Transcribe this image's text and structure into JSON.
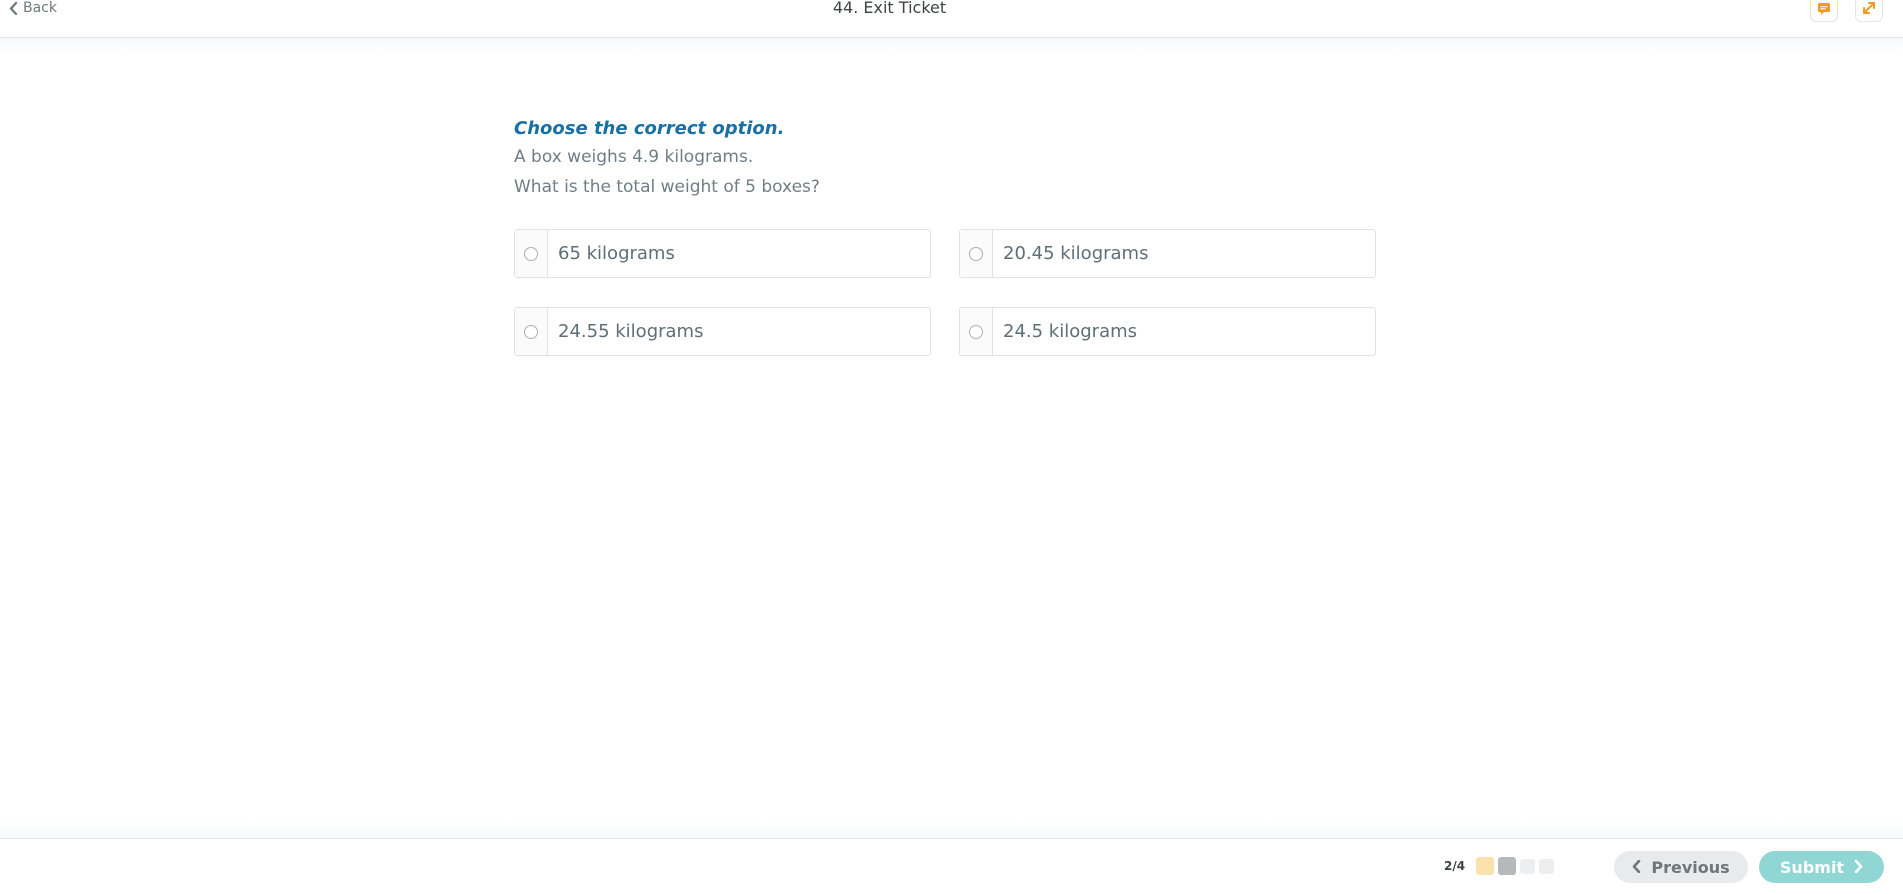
{
  "header": {
    "back_label": "Back",
    "title": "44. Exit Ticket",
    "icons": [
      "comment-flag-icon",
      "expand-icon"
    ]
  },
  "question": {
    "instruction": "Choose the correct option.",
    "stem_lines": [
      "A box weighs 4.9 kilograms.",
      "What is the total weight of 5 boxes?"
    ],
    "options": [
      "65 kilograms",
      "20.45 kilograms",
      "24.55 kilograms",
      "24.5 kilograms"
    ]
  },
  "footer": {
    "progress": "2/4",
    "progress_dots": [
      {
        "state": "answered",
        "color": "#fbe2ad"
      },
      {
        "state": "current",
        "color": "#b5b9bc"
      },
      {
        "state": "pending",
        "color": "#eceeef"
      },
      {
        "state": "pending",
        "color": "#eceeef"
      }
    ],
    "previous_label": "Previous",
    "submit_label": "Submit"
  },
  "colors": {
    "accent_blue": "#1a6fa3",
    "orange_icon": "#f39a1e",
    "submit_bg": "#8fd6d4",
    "previous_bg": "#e8eaec"
  }
}
